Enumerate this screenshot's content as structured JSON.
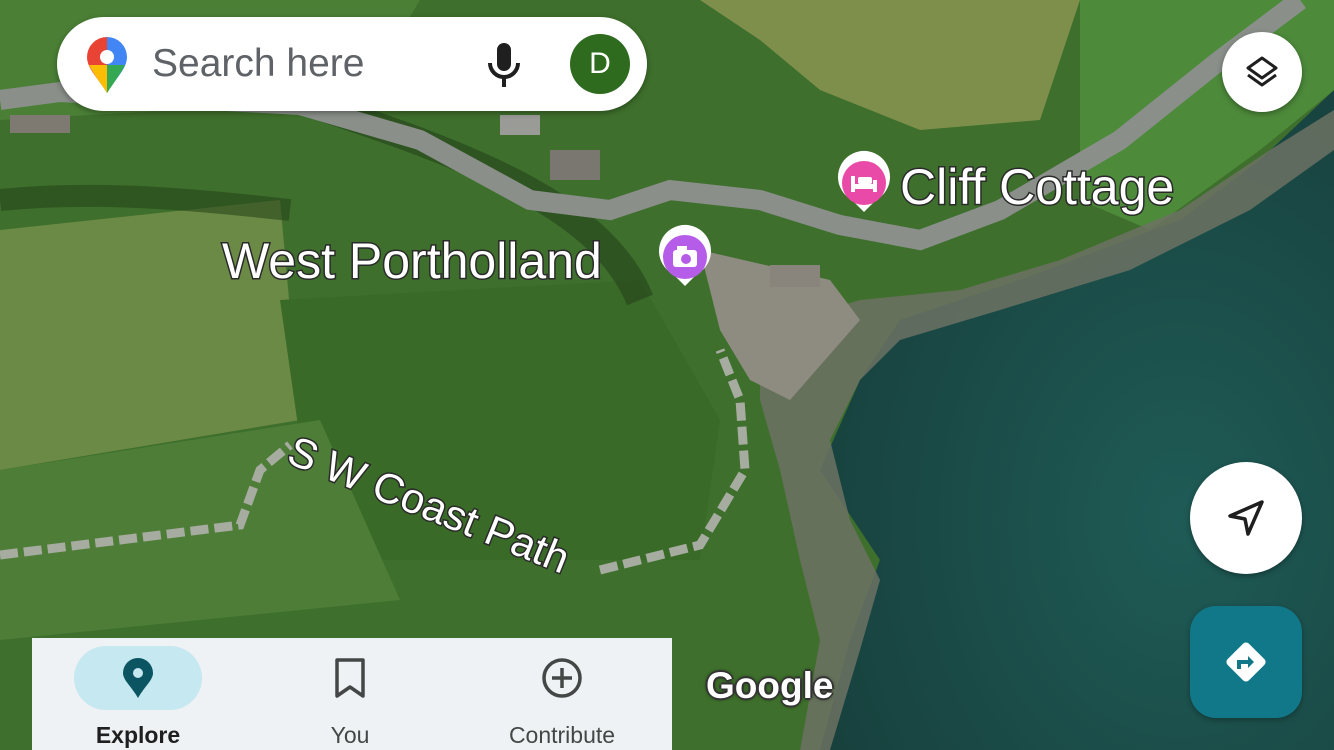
{
  "search": {
    "placeholder": "Search here",
    "avatar_initial": "D",
    "google_pin_icon": "google-maps-pin-icon",
    "mic_icon": "microphone-icon"
  },
  "map": {
    "type": "satellite",
    "places": [
      {
        "name": "West Portholland",
        "category": "photo-spot",
        "marker_color": "#b55de8"
      },
      {
        "name": "Cliff Cottage",
        "category": "lodging",
        "marker_color": "#e94aa8"
      }
    ],
    "paths": [
      {
        "name": "S W Coast Path"
      }
    ],
    "attribution": "Google"
  },
  "controls": {
    "layers_icon": "layers-icon",
    "locate_icon": "navigation-arrow-icon",
    "directions_icon": "directions-icon",
    "directions_color": "#11788a"
  },
  "bottom_nav": {
    "items": [
      {
        "label": "Explore",
        "icon": "location-pin-icon",
        "active": true
      },
      {
        "label": "You",
        "icon": "bookmark-icon",
        "active": false
      },
      {
        "label": "Contribute",
        "icon": "add-circle-icon",
        "active": false
      }
    ]
  }
}
